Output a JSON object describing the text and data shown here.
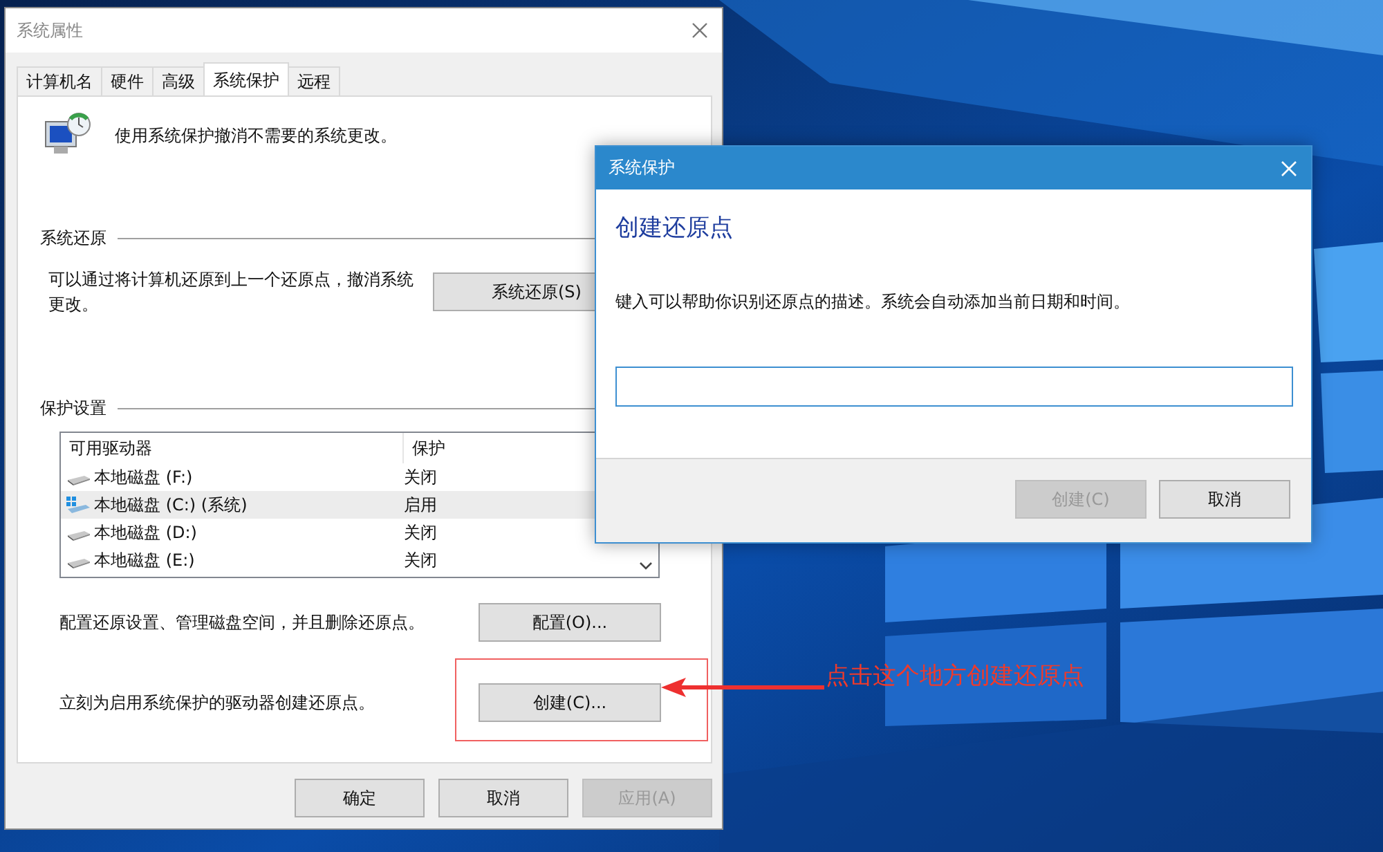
{
  "window": {
    "title": "系统属性",
    "tabs": [
      {
        "label": "计算机名",
        "selected": false
      },
      {
        "label": "硬件",
        "selected": false
      },
      {
        "label": "高级",
        "selected": false
      },
      {
        "label": "系统保护",
        "selected": true
      },
      {
        "label": "远程",
        "selected": false
      }
    ],
    "intro": "使用系统保护撤消不需要的系统更改。",
    "restore": {
      "heading": "系统还原",
      "text": "可以通过将计算机还原到上一个还原点，撤消系统更改。",
      "button": "系统还原(S)"
    },
    "protection": {
      "heading": "保护设置",
      "columns": [
        "可用驱动器",
        "保护"
      ],
      "drives": [
        {
          "name": "本地磁盘 (F:)",
          "status": "关闭",
          "kind": "drive",
          "selected": false
        },
        {
          "name": "本地磁盘 (C:) (系统)",
          "status": "启用",
          "kind": "system",
          "selected": true
        },
        {
          "name": "本地磁盘 (D:)",
          "status": "关闭",
          "kind": "drive",
          "selected": false
        },
        {
          "name": "本地磁盘 (E:)",
          "status": "关闭",
          "kind": "drive",
          "selected": false
        }
      ],
      "configure": {
        "text": "配置还原设置、管理磁盘空间，并且删除还原点。",
        "button": "配置(O)..."
      },
      "create": {
        "text": "立刻为启用系统保护的驱动器创建还原点。",
        "button": "创建(C)..."
      }
    },
    "buttons": [
      {
        "label": "确定",
        "disabled": false
      },
      {
        "label": "取消",
        "disabled": false
      },
      {
        "label": "应用(A)",
        "disabled": true
      }
    ]
  },
  "dialog": {
    "title": "系统保护",
    "heading": "创建还原点",
    "text": "键入可以帮助你识别还原点的描述。系统会自动添加当前日期和时间。",
    "buttons": [
      {
        "label": "创建(C)",
        "disabled": true
      },
      {
        "label": "取消",
        "disabled": false
      }
    ]
  },
  "annotation": {
    "text": "点击这个地方创建还原点"
  }
}
